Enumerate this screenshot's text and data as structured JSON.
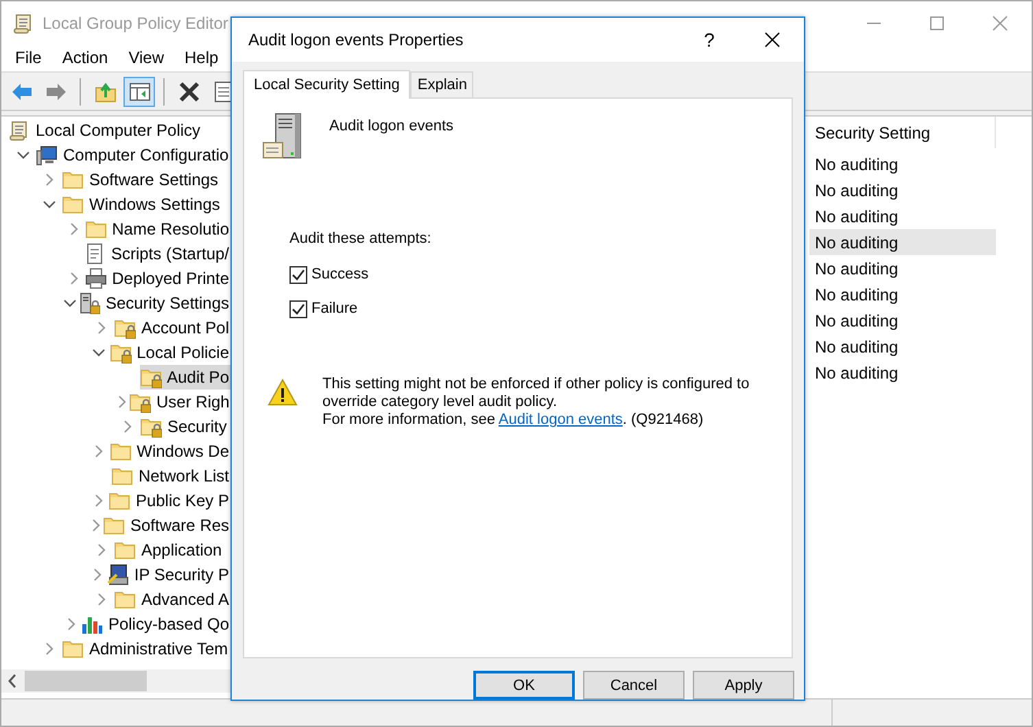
{
  "window": {
    "title": "Local Group Policy Editor"
  },
  "menu": [
    "File",
    "Action",
    "View",
    "Help"
  ],
  "toolbar": [
    {
      "kind": "back",
      "pressed": false
    },
    {
      "kind": "forward",
      "pressed": false
    },
    {
      "kind": "separator"
    },
    {
      "kind": "up-folder",
      "pressed": false
    },
    {
      "kind": "tree-toggle",
      "pressed": true
    },
    {
      "kind": "separator"
    },
    {
      "kind": "delete",
      "pressed": false
    },
    {
      "kind": "properties",
      "pressed": false
    }
  ],
  "tree": [
    {
      "label": "Local Computer Policy",
      "kind": "scroll",
      "selected": false,
      "children": [
        {
          "label": "Computer Configuratio",
          "kind": "computer",
          "selected": false,
          "expanded": true,
          "children": [
            {
              "label": "Software Settings",
              "kind": "folder",
              "selected": false,
              "expanded": false
            },
            {
              "label": "Windows Settings",
              "kind": "folder",
              "selected": false,
              "expanded": true,
              "children": [
                {
                  "label": "Name Resolutio",
                  "kind": "folder",
                  "selected": false,
                  "expanded": false
                },
                {
                  "label": "Scripts (Startup/",
                  "kind": "script",
                  "selected": false
                },
                {
                  "label": "Deployed Printe",
                  "kind": "printer",
                  "selected": false,
                  "expanded": false
                },
                {
                  "label": "Security Settings",
                  "kind": "server-lock",
                  "selected": false,
                  "expanded": true,
                  "children": [
                    {
                      "label": "Account Pol",
                      "kind": "lock-folder",
                      "selected": false,
                      "expanded": false
                    },
                    {
                      "label": "Local Policie",
                      "kind": "lock-folder",
                      "selected": false,
                      "expanded": true,
                      "children": [
                        {
                          "label": "Audit Po",
                          "kind": "lock-folder",
                          "selected": true
                        },
                        {
                          "label": "User Righ",
                          "kind": "lock-folder",
                          "selected": false,
                          "expanded": false
                        },
                        {
                          "label": "Security",
                          "kind": "lock-folder",
                          "selected": false,
                          "expanded": false
                        }
                      ]
                    },
                    {
                      "label": "Windows De",
                      "kind": "folder",
                      "selected": false,
                      "expanded": false
                    },
                    {
                      "label": "Network List",
                      "kind": "folder",
                      "selected": false
                    },
                    {
                      "label": "Public Key P",
                      "kind": "folder",
                      "selected": false,
                      "expanded": false
                    },
                    {
                      "label": "Software Res",
                      "kind": "folder",
                      "selected": false,
                      "expanded": false
                    },
                    {
                      "label": "Application",
                      "kind": "folder",
                      "selected": false,
                      "expanded": false
                    },
                    {
                      "label": "IP Security P",
                      "kind": "monitor-key",
                      "selected": false,
                      "expanded": false
                    },
                    {
                      "label": "Advanced A",
                      "kind": "folder",
                      "selected": false,
                      "expanded": false
                    }
                  ]
                },
                {
                  "label": "Policy-based Qo",
                  "kind": "chart",
                  "selected": false,
                  "expanded": false
                }
              ]
            },
            {
              "label": "Administrative Tem",
              "kind": "folder",
              "selected": false,
              "expanded": false
            }
          ]
        }
      ]
    }
  ],
  "details_pane": {
    "column_header": "Security Setting",
    "rows": [
      {
        "value": "No auditing",
        "selected": false
      },
      {
        "value": "No auditing",
        "selected": false
      },
      {
        "value": "No auditing",
        "selected": false
      },
      {
        "value": "No auditing",
        "selected": true
      },
      {
        "value": "No auditing",
        "selected": false
      },
      {
        "value": "No auditing",
        "selected": false
      },
      {
        "value": "No auditing",
        "selected": false
      },
      {
        "value": "No auditing",
        "selected": false
      },
      {
        "value": "No auditing",
        "selected": false
      }
    ]
  },
  "dialog": {
    "title": "Audit logon events Properties",
    "help": "?",
    "tabs": [
      {
        "label": "Local Security Setting",
        "selected": true
      },
      {
        "label": "Explain",
        "selected": false
      }
    ],
    "policy_name": "Audit logon events",
    "attempts_label": "Audit these attempts:",
    "attempts": [
      {
        "label": "Success",
        "checked": true
      },
      {
        "label": "Failure",
        "checked": true
      }
    ],
    "warning": {
      "text": "This setting might not be enforced if other policy is configured to override category level audit policy.",
      "more_before": "For more information, see ",
      "more_link": "Audit logon events",
      "more_after": ". (Q921468)"
    },
    "buttons": [
      {
        "label": "OK",
        "default": true
      },
      {
        "label": "Cancel",
        "default": false
      },
      {
        "label": "Apply",
        "default": false
      }
    ]
  }
}
